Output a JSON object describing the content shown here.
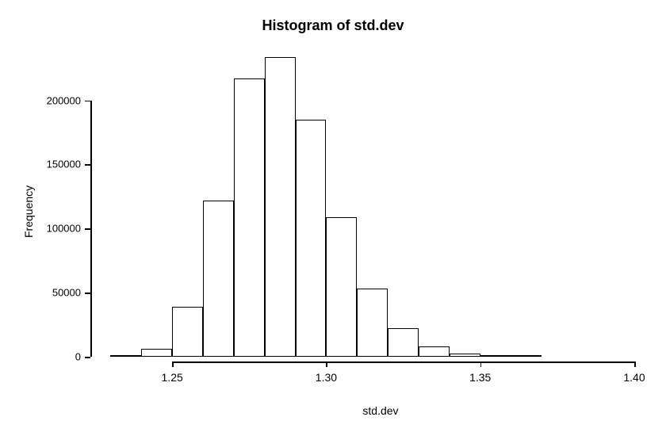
{
  "chart_data": {
    "type": "bar",
    "title": "Histogram of std.dev",
    "xlabel": "std.dev",
    "ylabel": "Frequency",
    "xlim": [
      1.225,
      1.4
    ],
    "ylim": [
      0,
      235000
    ],
    "x_ticks": [
      1.25,
      1.3,
      1.35,
      1.4
    ],
    "y_ticks": [
      0,
      50000,
      100000,
      150000,
      200000
    ],
    "bin_width": 0.01,
    "categories": [
      1.23,
      1.24,
      1.25,
      1.26,
      1.27,
      1.28,
      1.29,
      1.3,
      1.31,
      1.32,
      1.33,
      1.34,
      1.35,
      1.36
    ],
    "values": [
      600,
      6000,
      39000,
      122000,
      217000,
      234000,
      185000,
      109000,
      53000,
      22000,
      8000,
      2500,
      900,
      500
    ]
  }
}
